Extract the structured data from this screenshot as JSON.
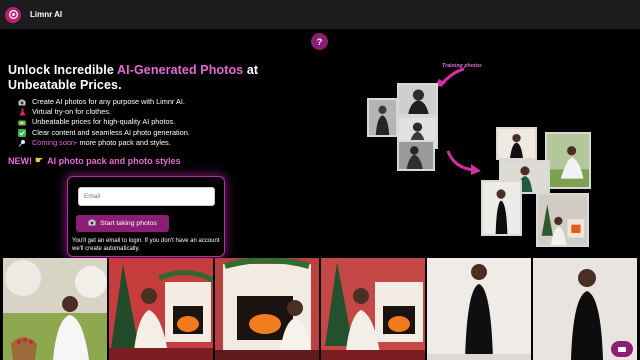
{
  "app": {
    "brand": "Limnr AI"
  },
  "help": {
    "label": "?"
  },
  "hero": {
    "headline_part1": "Unlock Incredible ",
    "headline_accent": "AI-Generated Photos",
    "headline_part2": " at Unbeatable Prices.",
    "features": [
      {
        "icon": "camera-icon",
        "text": "Create AI photos for any purpose with Limnr AI."
      },
      {
        "icon": "dress-icon",
        "text": "Virtual try-on for clothes."
      },
      {
        "icon": "money-icon",
        "text": "Unbeatable prices for high-quality AI photos."
      },
      {
        "icon": "checkmark-icon",
        "text": "Clear content and seamless AI photo generation."
      }
    ],
    "coming_soon": {
      "icon": "pin-icon",
      "prefix": "Coming soon",
      "suffix": " - more photo pack and styles."
    },
    "new_badge": "NEW!",
    "new_icon": "pointing-hand-icon",
    "new_text": "AI photo pack and photo styles"
  },
  "signup": {
    "email_placeholder": "Email",
    "button_label": "Start taking photos",
    "button_icon": "camera-icon",
    "note": "You'll get an email to login. If you don't have an account we'll create automatically."
  },
  "illustration": {
    "training_label": "Training photos"
  },
  "colors": {
    "accent": "#e56ad6",
    "button": "#8d1e76",
    "topbar": "#1c1c1e"
  }
}
